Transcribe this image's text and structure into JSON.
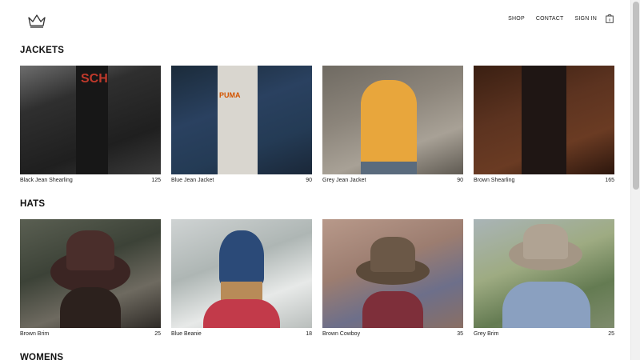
{
  "header": {
    "logo_icon": "crown-icon",
    "nav": [
      "SHOP",
      "CONTACT",
      "SIGN IN"
    ],
    "bag_icon": "shopping-bag-icon",
    "bag_count": "0"
  },
  "sections": [
    {
      "title": "JACKETS",
      "items": [
        {
          "name": "Black Jean Shearling",
          "price": "125"
        },
        {
          "name": "Blue Jean Jacket",
          "price": "90"
        },
        {
          "name": "Grey Jean Jacket",
          "price": "90"
        },
        {
          "name": "Brown Shearling",
          "price": "165"
        }
      ]
    },
    {
      "title": "HATS",
      "items": [
        {
          "name": "Brown Brim",
          "price": "25"
        },
        {
          "name": "Blue Beanie",
          "price": "18"
        },
        {
          "name": "Brown Cowboy",
          "price": "35"
        },
        {
          "name": "Grey Brim",
          "price": "25"
        }
      ]
    },
    {
      "title": "WOMENS",
      "items": []
    }
  ]
}
